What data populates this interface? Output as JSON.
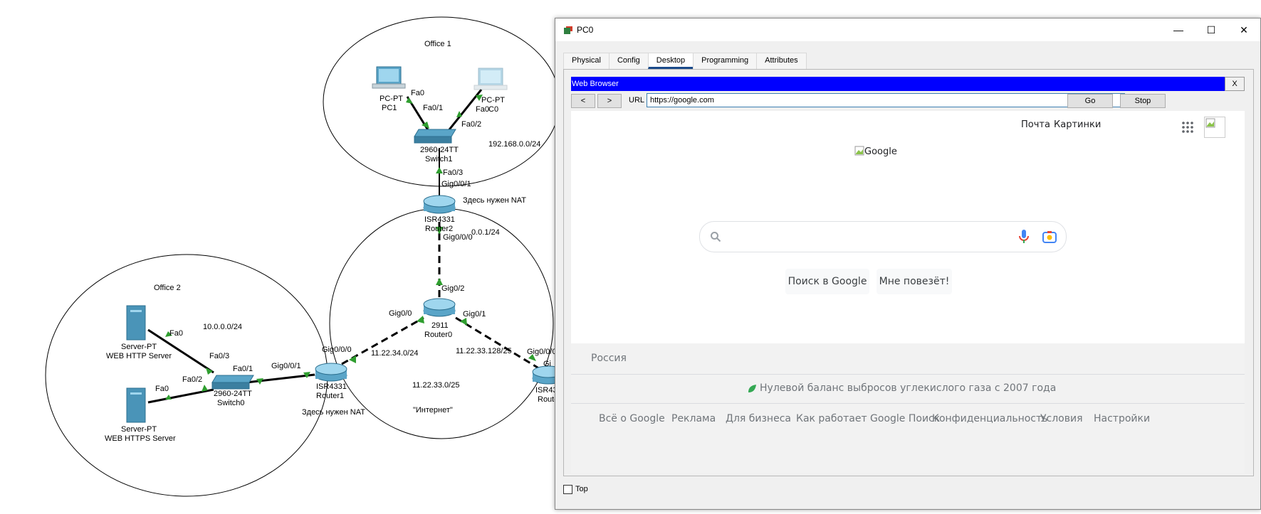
{
  "topology": {
    "offices": {
      "office1": "Office 1",
      "office2": "Office 2"
    },
    "networks": {
      "net_office1": "192.168.0.0/24",
      "net_office2": "10.0.0.0/24",
      "net_r2_r0": "0.0.1/24",
      "net_r1_r0": "11.22.34.0/24",
      "net_r0_r3": "11.22.33.128/25",
      "net_internet": "11.22.33.0/25"
    },
    "internet_label": "\"Интернет\"",
    "nat_note_router2": "Здесь нужен NAT",
    "nat_note_router1": "Здесь нужен NAT",
    "devices": {
      "pc1_type": "PC-PT",
      "pc1_name": "PC1",
      "pc0_type": "PC-PT",
      "pc0_name": "C0",
      "switch1_type": "2960-24TT",
      "switch1_name": "Switch1",
      "router2_type": "ISR4331",
      "router2_name": "Router2",
      "router0_type": "2911",
      "router0_name": "Router0",
      "router1_type": "ISR4331",
      "router1_name": "Router1",
      "router3_type": "ISR43",
      "router3_name": "Route",
      "switch0_type": "2960-24TT",
      "switch0_name": "Switch0",
      "server_http_type": "Server-PT",
      "server_http_name": "WEB HTTP Server",
      "server_https_type": "Server-PT",
      "server_https_name": "WEB HTTPS Server"
    },
    "ports": {
      "pc1_fa0": "Fa0",
      "sw1_fa01": "Fa0/1",
      "pc0_fa0": "Fa0",
      "sw1_fa02": "Fa0/2",
      "sw1_fa03": "Fa0/3",
      "r2_gig001": "Gig0/0/1",
      "r2_gig000": "Gig0/0/0",
      "r0_gig02": "Gig0/2",
      "r0_gig00": "Gig0/0",
      "r0_gig01": "Gig0/1",
      "r1_gig000": "Gig0/0/0",
      "r1_gig001": "Gig0/0/1",
      "r3_gig000": "Gig0/0/0",
      "r3_gig_partial": "Gi",
      "sw0_fa01": "Fa0/1",
      "sw0_fa03": "Fa0/3",
      "sw0_fa02": "Fa0/2",
      "http_fa0": "Fa0",
      "https_fa0": "Fa0"
    }
  },
  "window": {
    "title": "PC0",
    "controls": {
      "minimize": "—",
      "maximize": "☐",
      "close": "✕"
    },
    "tabs": [
      "Physical",
      "Config",
      "Desktop",
      "Programming",
      "Attributes"
    ],
    "active_tab": "Desktop"
  },
  "browser": {
    "title": "Web Browser",
    "close": "X",
    "back": "<",
    "forward": ">",
    "url_label": "URL",
    "url": "https://google.com",
    "go": "Go",
    "stop": "Stop"
  },
  "google": {
    "top_links": {
      "mail": "Почта",
      "images": "Картинки"
    },
    "logo_alt": "Google",
    "buttons": {
      "search": "Поиск в Google",
      "lucky": "Мне повезёт!"
    },
    "country": "Россия",
    "carbon": "Нулевой баланс выбросов углекислого газа с 2007 года",
    "footer_links": [
      "Всё о Google",
      "Реклама",
      "Для бизнеса",
      "Как работает Google Поиск",
      "Конфиденциальность",
      "Условия",
      "Настройки"
    ],
    "colors": {
      "mic_blue": "#4285f4",
      "mic_red": "#ea4335",
      "leaf_green": "#34a853"
    }
  },
  "checkbox_top": "Top",
  "colors": {
    "browser_titlebar": "#0000ff",
    "link_green": "#2f9e2f"
  }
}
